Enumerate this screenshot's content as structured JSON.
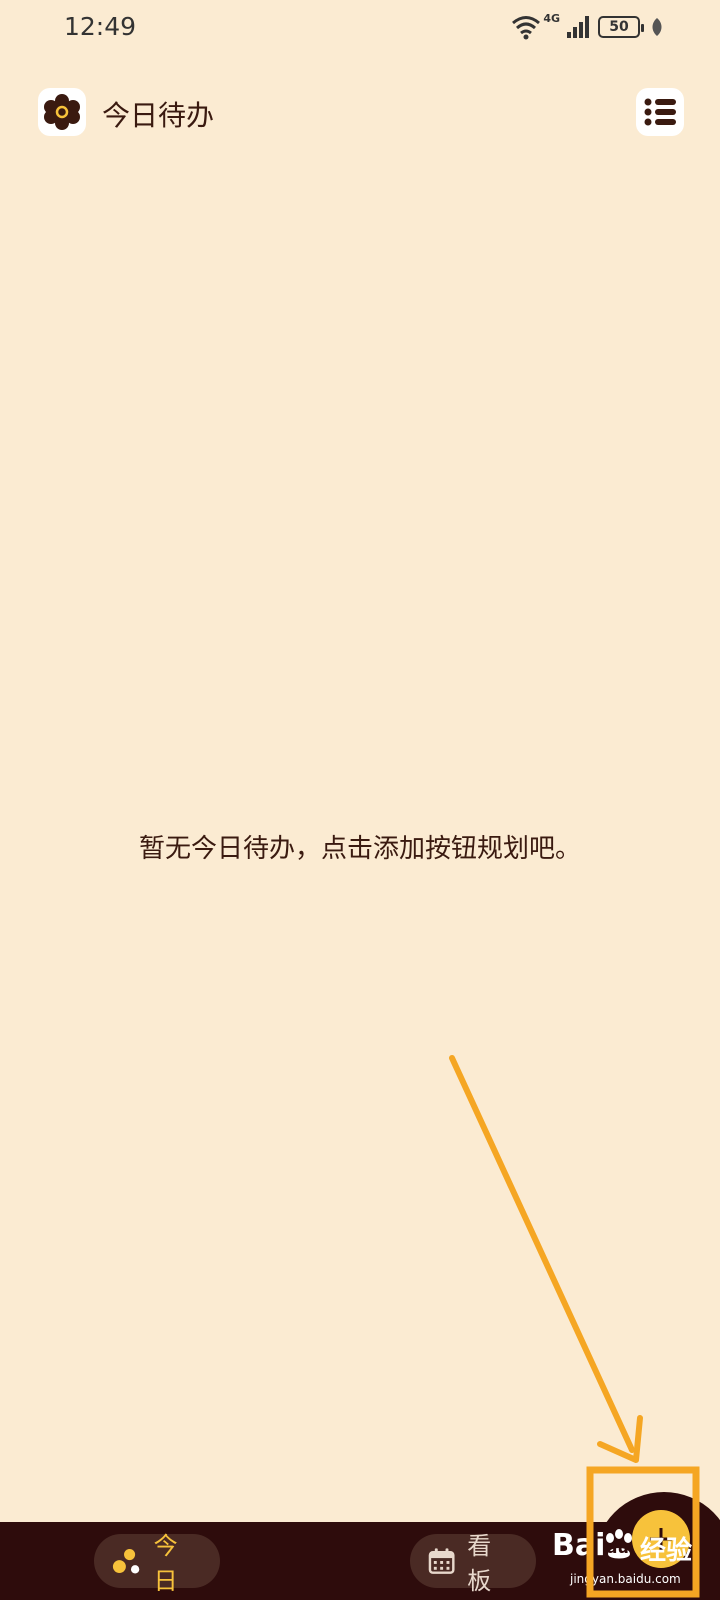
{
  "status_bar": {
    "time": "12:49",
    "network": "4G",
    "battery": "50"
  },
  "header": {
    "title": "今日待办",
    "logo_icon": "flower-icon",
    "menu_icon": "list-icon"
  },
  "main": {
    "empty_message": "暂无今日待办，点击添加按钮规划吧。"
  },
  "bottom_nav": {
    "today_label": "今日",
    "board_label": "看板",
    "add_icon": "plus-icon"
  },
  "watermark": {
    "brand_left": "Bai",
    "brand_du": "du",
    "brand_right": "经验",
    "url": "jingyan.baidu.com"
  },
  "colors": {
    "background": "#FBEBD2",
    "bar": "#2E0C0C",
    "accent": "#F7C23B",
    "annotation": "#F5A623"
  }
}
